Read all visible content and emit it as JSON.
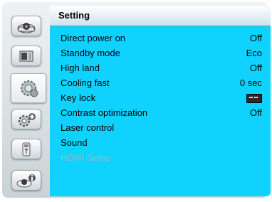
{
  "sidebar": {
    "items": [
      {
        "name": "projector-icon"
      },
      {
        "name": "image-settings-icon"
      },
      {
        "name": "setting-icon",
        "selected": true
      },
      {
        "name": "expand-icon"
      },
      {
        "name": "usb-memory-icon"
      },
      {
        "name": "information-icon"
      }
    ]
  },
  "panel": {
    "title": "Setting",
    "rows": [
      {
        "label": "Direct power on",
        "value": "Off"
      },
      {
        "label": "Standby mode",
        "value": "Eco"
      },
      {
        "label": "High land",
        "value": "Off"
      },
      {
        "label": "Cooling fast",
        "value": "0 sec"
      },
      {
        "label": "Key lock",
        "value": "",
        "icon": "keyboard-lock-icon"
      },
      {
        "label": "Contrast optimization",
        "value": "Off"
      },
      {
        "label": "Laser control",
        "value": ""
      },
      {
        "label": "Sound",
        "value": ""
      },
      {
        "label": "HDMI Setup",
        "value": "",
        "disabled": true
      }
    ]
  },
  "colors": {
    "panel_background": "#0fd2ff",
    "disabled_text": "#8fb8c5"
  }
}
